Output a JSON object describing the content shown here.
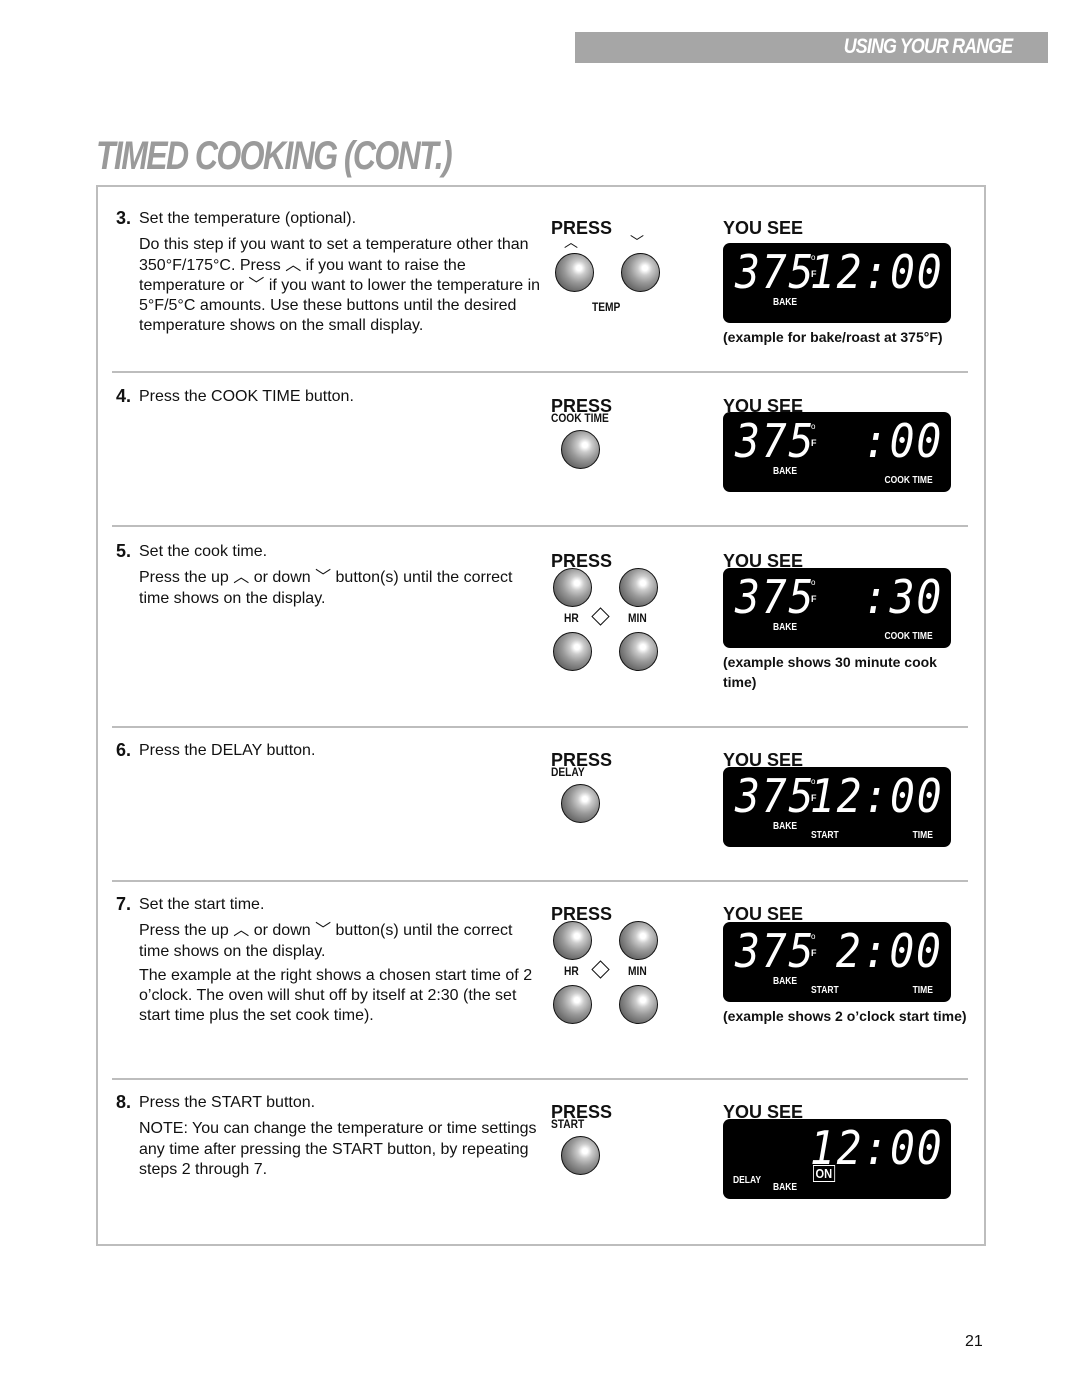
{
  "header": {
    "section": "USING YOUR RANGE",
    "title": "TIMED COOKING (CONT.)"
  },
  "press_heading": "PRESS",
  "yousee_heading": "YOU SEE",
  "steps": [
    {
      "number": "3.",
      "paragraphs": [
        "Set the temperature (optional).",
        "Do this step if you want to set a temperature other than 350°F/175°C. Press ︿ if you want to raise the temperature or ﹀ if you want to lower the temperature in 5°F/5°C amounts. Use these buttons until the desired temperature shows on the small display."
      ],
      "press": {
        "type": "updown",
        "label": "TEMP"
      },
      "display": {
        "temp": "375",
        "time": "12:00",
        "labels": [
          "BAKE"
        ],
        "right_label": ""
      },
      "caption": "(example for bake/roast at 375°F)"
    },
    {
      "number": "4.",
      "paragraphs": [
        "Press the COOK TIME button."
      ],
      "press": {
        "type": "single",
        "label": "COOK TIME"
      },
      "display": {
        "temp": "375",
        "time": ":00",
        "labels": [
          "BAKE"
        ],
        "right_label": "COOK TIME"
      },
      "caption": ""
    },
    {
      "number": "5.",
      "paragraphs": [
        "Set the cook time.",
        "Press the up ︿ or down ﹀ button(s) until the correct time shows on the display."
      ],
      "press": {
        "type": "hrmin",
        "hr": "HR",
        "min": "MIN"
      },
      "display": {
        "temp": "375",
        "time": ":30",
        "labels": [
          "BAKE"
        ],
        "right_label": "COOK TIME"
      },
      "caption": "(example shows 30 minute cook time)"
    },
    {
      "number": "6.",
      "paragraphs": [
        "Press the DELAY button."
      ],
      "press": {
        "type": "single",
        "label": "DELAY"
      },
      "display": {
        "temp": "375",
        "time": "12:00",
        "labels": [
          "BAKE",
          "START"
        ],
        "right_label": "TIME"
      },
      "caption": ""
    },
    {
      "number": "7.",
      "paragraphs": [
        "Set the start time.",
        "Press the up ︿ or down ﹀ button(s) until the correct time shows on the display.",
        "The example at the right shows a chosen start time of 2 o’clock. The oven will shut off by itself at 2:30 (the set start time plus the set cook time)."
      ],
      "press": {
        "type": "hrmin",
        "hr": "HR",
        "min": "MIN"
      },
      "display": {
        "temp": "375",
        "time": "2:00",
        "labels": [
          "BAKE",
          "START"
        ],
        "right_label": "TIME"
      },
      "caption": "(example shows 2 o’clock start time)"
    },
    {
      "number": "8.",
      "paragraphs": [
        "Press the START button.",
        "NOTE: You can change the temperature or time settings any time after pressing the START button, by repeating steps 2 through 7."
      ],
      "press": {
        "type": "single",
        "label": "START"
      },
      "display": {
        "temp": "",
        "time": "12:00",
        "labels": [
          "DELAY",
          "BAKE"
        ],
        "right_label": "",
        "on": "ON"
      },
      "caption": ""
    }
  ],
  "page_number": "21"
}
